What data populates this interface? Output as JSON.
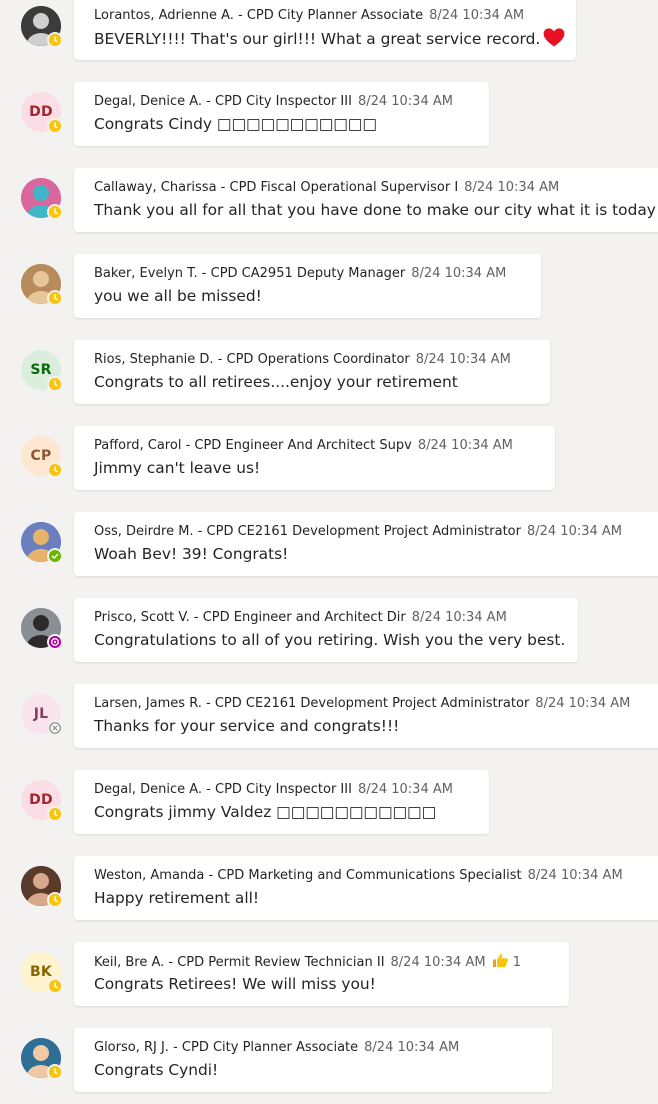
{
  "colors": {
    "away": "#f8c50a",
    "available": "#6bb700",
    "dnd_focus": "#b4009e",
    "offline": "#8a8886",
    "heart": "#e81123"
  },
  "messages": [
    {
      "author": "Lorantos, Adrienne A. - CPD City Planner Associate",
      "time": "8/24 10:34 AM",
      "text": "BEVERLY!!!! That's our girl!!! What a great service record.",
      "heart": true,
      "avatar": {
        "type": "photo",
        "bg": "#3b3b3b",
        "fg": "#cfcfcf"
      },
      "status": "away",
      "bubble_w": 502
    },
    {
      "author": "Degal, Denice A. - CPD City Inspector III",
      "time": "8/24 10:34 AM",
      "text": "Congrats Cindy □□□□□□□□□□□",
      "avatar": {
        "type": "initials",
        "initials": "DD",
        "bg": "#fbdde6",
        "fg": "#a4262c"
      },
      "status": "away",
      "bubble_w": 415
    },
    {
      "author": "Callaway, Charissa - CPD Fiscal Operational Supervisor I",
      "time": "8/24 10:34 AM",
      "text": "Thank you all for all that you have done to make our city what it is today!",
      "avatar": {
        "type": "photo",
        "bg": "#d9669c",
        "fg": "#3fb7c8"
      },
      "status": "away",
      "bubble_w": 600
    },
    {
      "author": "Baker, Evelyn T. - CPD CA2951 Deputy Manager",
      "time": "8/24 10:34 AM",
      "text": "you we all be missed!",
      "avatar": {
        "type": "photo",
        "bg": "#b78b5c",
        "fg": "#e7c79a"
      },
      "status": "away",
      "bubble_w": 467
    },
    {
      "author": "Rios, Stephanie D. - CPD Operations Coordinator",
      "time": "8/24 10:34 AM",
      "text": "Congrats to all retirees....enjoy your retirement",
      "avatar": {
        "type": "initials",
        "initials": "SR",
        "bg": "#dbeedd",
        "fg": "#0b6a0b"
      },
      "status": "away",
      "bubble_w": 476
    },
    {
      "author": "Pafford, Carol - CPD Engineer And Architect Supv",
      "time": "8/24 10:34 AM",
      "text": "Jimmy can't leave us!",
      "avatar": {
        "type": "initials",
        "initials": "CP",
        "bg": "#fde7d0",
        "fg": "#8e562e"
      },
      "status": "away",
      "bubble_w": 481
    },
    {
      "author": "Oss, Deirdre M. - CPD CE2161 Development Project Administrator",
      "time": "8/24 10:34 AM",
      "text": "Woah Bev! 39! Congrats!",
      "avatar": {
        "type": "photo",
        "bg": "#6a7fbf",
        "fg": "#e8b36a"
      },
      "status": "available",
      "bubble_w": 590
    },
    {
      "author": "Prisco, Scott V. - CPD Engineer and Architect Dir",
      "time": "8/24 10:34 AM",
      "text": "Congratulations to all of you retiring. Wish you the very best.",
      "avatar": {
        "type": "photo",
        "bg": "#8a8f96",
        "fg": "#2b2b2b"
      },
      "status": "dnd_focus",
      "bubble_w": 504
    },
    {
      "author": "Larsen, James R. - CPD CE2161 Development Project Administrator",
      "time": "8/24 10:34 AM",
      "text": "Thanks for your service and congrats!!!",
      "avatar": {
        "type": "initials",
        "initials": "JL",
        "bg": "#f9e3ed",
        "fg": "#8e3a5a"
      },
      "status": "offline",
      "bubble_w": 590
    },
    {
      "author": "Degal, Denice A. - CPD City Inspector III",
      "time": "8/24 10:34 AM",
      "text": "Congrats jimmy Valdez □□□□□□□□□□□",
      "avatar": {
        "type": "initials",
        "initials": "DD",
        "bg": "#fbdde6",
        "fg": "#a4262c"
      },
      "status": "away",
      "bubble_w": 415
    },
    {
      "author": "Weston, Amanda - CPD Marketing and Communications Specialist",
      "time": "8/24 10:34 AM",
      "text": "Happy retirement all!",
      "avatar": {
        "type": "photo",
        "bg": "#5a3a2a",
        "fg": "#d7a98a"
      },
      "status": "away",
      "bubble_w": 590
    },
    {
      "author": "Keil, Bre A. - CPD Permit Review Technician II",
      "time": "8/24 10:34 AM",
      "text": "Congrats Retirees! We will miss you!",
      "reaction": {
        "icon": "thumbs-up-icon",
        "count": "1"
      },
      "avatar": {
        "type": "initials",
        "initials": "BK",
        "bg": "#fff4ce",
        "fg": "#8a6400"
      },
      "status": "away",
      "bubble_w": 495
    },
    {
      "author": "Glorso, RJ J. - CPD City Planner Associate",
      "time": "8/24 10:34 AM",
      "text": "Congrats Cyndi!",
      "avatar": {
        "type": "photo",
        "bg": "#2f6f96",
        "fg": "#f0c9a4"
      },
      "status": "away",
      "bubble_w": 478
    }
  ]
}
